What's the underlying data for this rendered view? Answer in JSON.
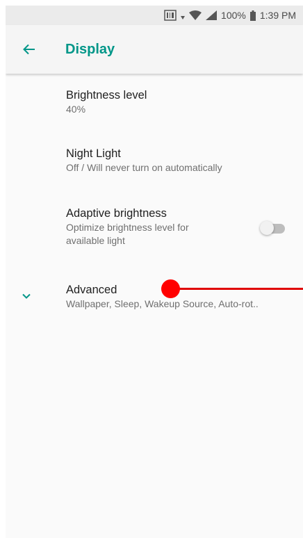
{
  "status_bar": {
    "battery_percent": "100%",
    "time": "1:39 PM"
  },
  "app_bar": {
    "title": "Display",
    "back_icon": "arrow-back-icon"
  },
  "settings": [
    {
      "title": "Brightness level",
      "summary": "40%"
    },
    {
      "title": "Night Light",
      "summary": "Off / Will never turn on automatically"
    },
    {
      "title": "Adaptive brightness",
      "summary": "Optimize brightness level for available light",
      "toggle_on": false
    },
    {
      "title": "Advanced",
      "summary": "Wallpaper, Sleep, Wakeup Source, Auto-rot..",
      "icon": "chevron-down-icon"
    }
  ],
  "colors": {
    "accent": "#009688",
    "touch_marker": "#ff0000"
  }
}
